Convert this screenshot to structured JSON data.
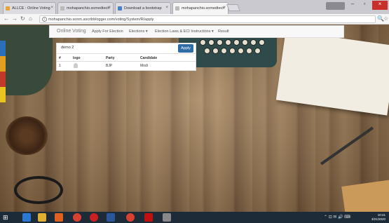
{
  "browser": {
    "tabs": [
      {
        "title": "ALLCE : Online Voting",
        "active": false
      },
      {
        "title": "mohapanchio.somedtech",
        "active": false
      },
      {
        "title": "Download a bootstrap",
        "active": false
      },
      {
        "title": "mohapanchio.somedtech",
        "active": true
      }
    ],
    "url": "mohapanchio.sonm.ascribblogger.com/voting/System/R/apply"
  },
  "app": {
    "brand": "Online Voting",
    "nav": [
      "Apply For Election",
      "Elections ▾",
      "Election Laws & ECI Instructions ▾",
      "Result"
    ]
  },
  "results": {
    "panel_title": "demo 2",
    "apply_label": "Apply",
    "columns": [
      "#",
      "logo",
      "Party",
      "Candidate"
    ],
    "rows": [
      {
        "num": "1",
        "party": "BJP",
        "candidate": "Modi"
      }
    ]
  },
  "taskbar": {
    "time": "10:41",
    "date": "3/21/2020"
  },
  "colors": {
    "accent": "#2e6da4",
    "close": "#c9302c"
  }
}
